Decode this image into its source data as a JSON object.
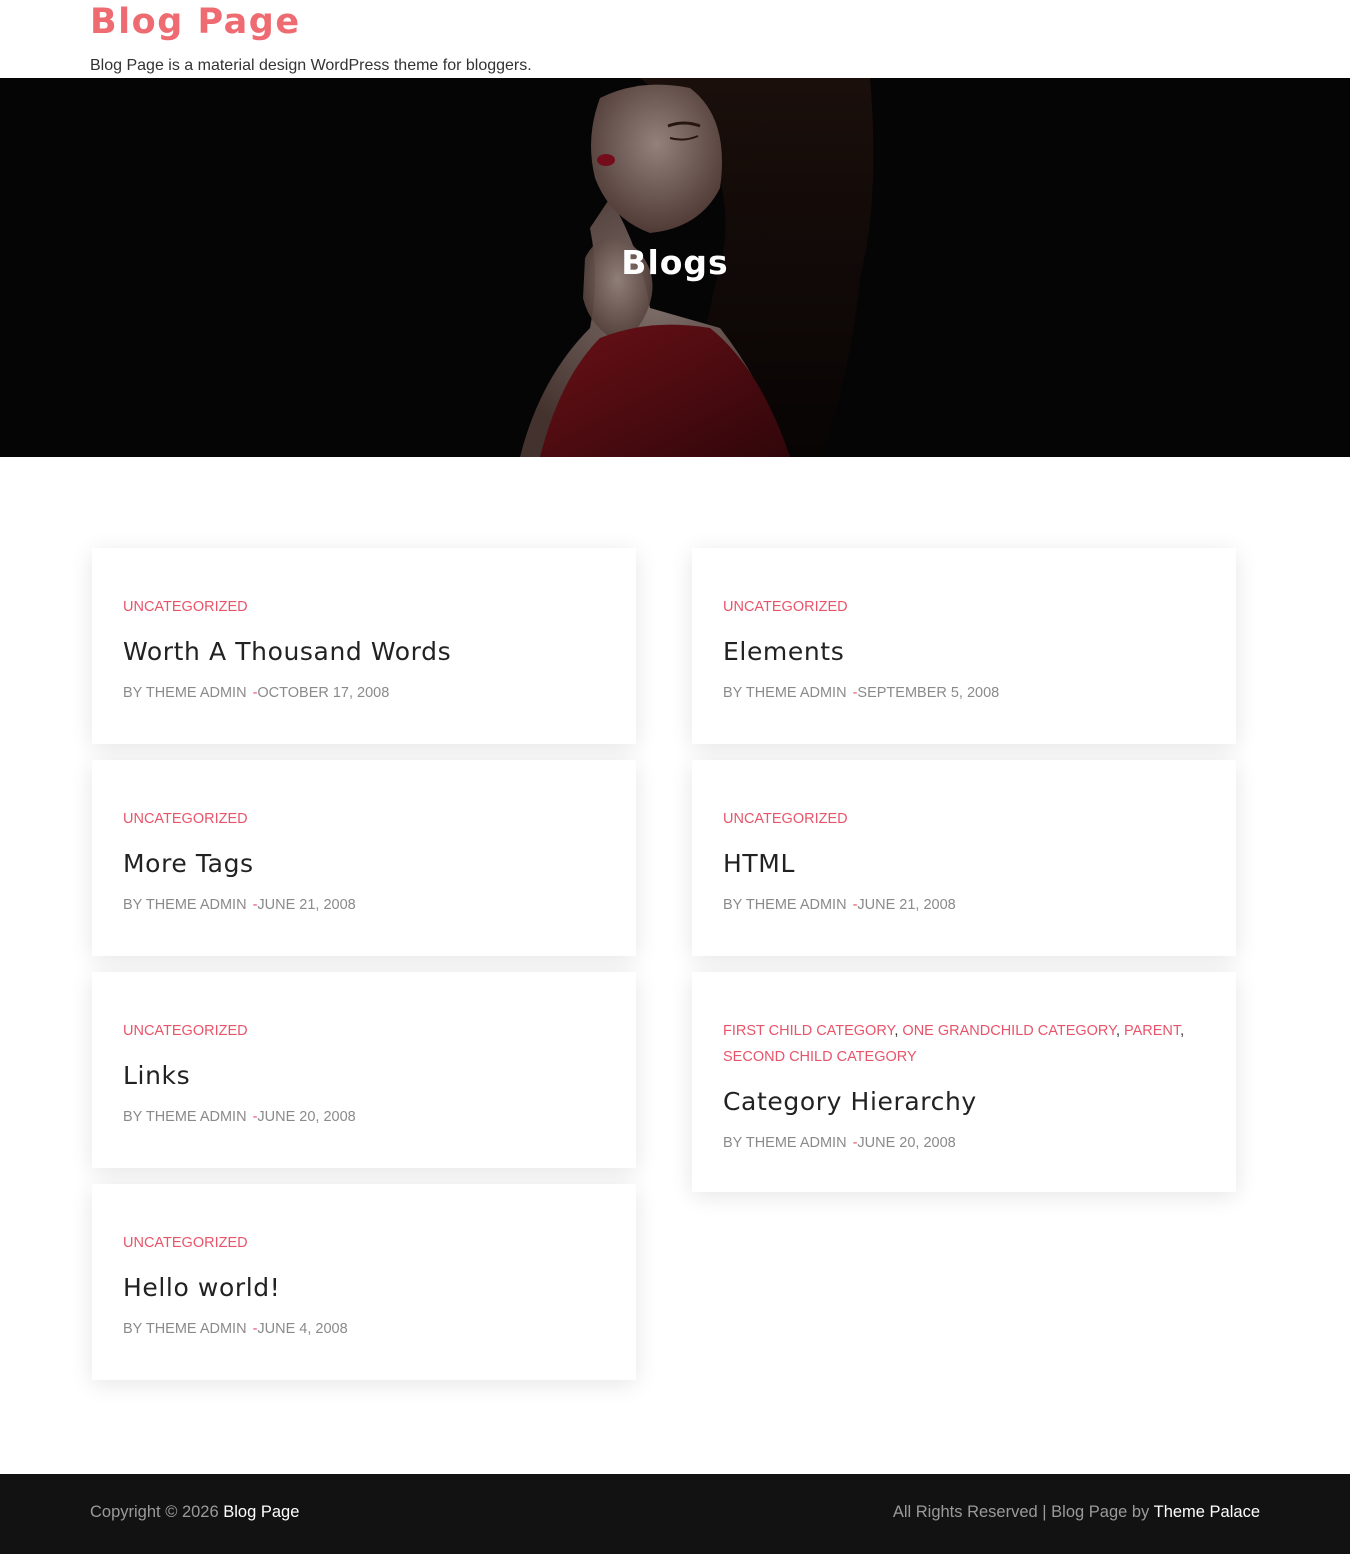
{
  "site": {
    "title": "Blog Page",
    "description": "Blog Page is a material design WordPress theme for bloggers."
  },
  "hero": {
    "title": "Blogs"
  },
  "posts": [
    {
      "categories": [
        "UNCATEGORIZED"
      ],
      "title": "Worth A Thousand Words",
      "author": "BY THEME ADMIN",
      "date": "OCTOBER 17, 2008"
    },
    {
      "categories": [
        "UNCATEGORIZED"
      ],
      "title": "Elements",
      "author": "BY THEME ADMIN",
      "date": "SEPTEMBER 5, 2008"
    },
    {
      "categories": [
        "UNCATEGORIZED"
      ],
      "title": "More Tags",
      "author": "BY THEME ADMIN",
      "date": "JUNE 21, 2008"
    },
    {
      "categories": [
        "UNCATEGORIZED"
      ],
      "title": "HTML",
      "author": "BY THEME ADMIN",
      "date": "JUNE 21, 2008"
    },
    {
      "categories": [
        "UNCATEGORIZED"
      ],
      "title": "Links",
      "author": "BY THEME ADMIN",
      "date": "JUNE 20, 2008"
    },
    {
      "categories": [
        "FIRST CHILD CATEGORY",
        "ONE GRANDCHILD CATEGORY",
        "PARENT",
        "SECOND CHILD CATEGORY"
      ],
      "title": "Category Hierarchy",
      "author": "BY THEME ADMIN",
      "date": "JUNE 20, 2008"
    },
    {
      "categories": [
        "UNCATEGORIZED"
      ],
      "title": "Hello world!",
      "author": "BY THEME ADMIN",
      "date": "JUNE 4, 2008"
    }
  ],
  "footer": {
    "copyright_prefix": "Copyright © 2026",
    "copyright_link": "Blog Page",
    "rights_prefix": "All Rights Reserved | Blog Page by",
    "rights_link": "Theme Palace"
  },
  "colors": {
    "accent": "#ef6b72",
    "category": "#e8546a",
    "hero_bg": "#090909",
    "footer_bg": "#121212"
  }
}
